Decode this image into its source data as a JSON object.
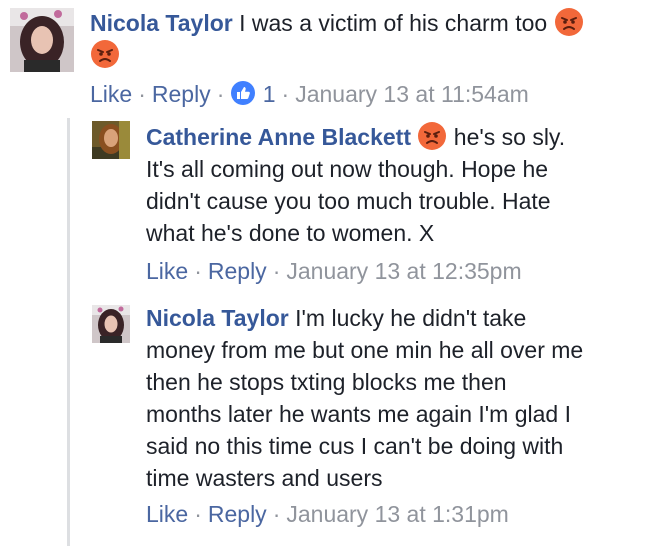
{
  "colors": {
    "author_link": "#365899",
    "action_link": "#4b67a1",
    "meta_gray": "#90949c",
    "text": "#1d2129",
    "like_badge": "#4080ff",
    "angry_emoji": "#f2683a"
  },
  "comments": [
    {
      "author": "Nicola Taylor",
      "lines": [
        "I was a victim of his charm too"
      ],
      "emojis": [
        "angry-face",
        "angry-face"
      ],
      "actions": {
        "like": "Like",
        "reply": "Reply",
        "reaction_count": "1",
        "timestamp": "January 13 at 11:54am"
      }
    },
    {
      "author": "Catherine Anne Blackett",
      "lines": [
        "he's so sly.",
        "It's all coming out now though. Hope he",
        "didn't cause you too much trouble. Hate",
        "what he's done to women. X"
      ],
      "emojis": [
        "angry-face"
      ],
      "actions": {
        "like": "Like",
        "reply": "Reply",
        "timestamp": "January 13 at 12:35pm"
      }
    },
    {
      "author": "Nicola Taylor",
      "lines": [
        "I'm lucky he didn't take",
        "money from me but one min he all over me",
        "then he stops txting blocks me then",
        "months later he wants me again I'm glad I",
        "said no this time cus I can't be doing with",
        "time wasters and users"
      ],
      "actions": {
        "like": "Like",
        "reply": "Reply",
        "timestamp": "January 13 at 1:31pm"
      }
    }
  ]
}
